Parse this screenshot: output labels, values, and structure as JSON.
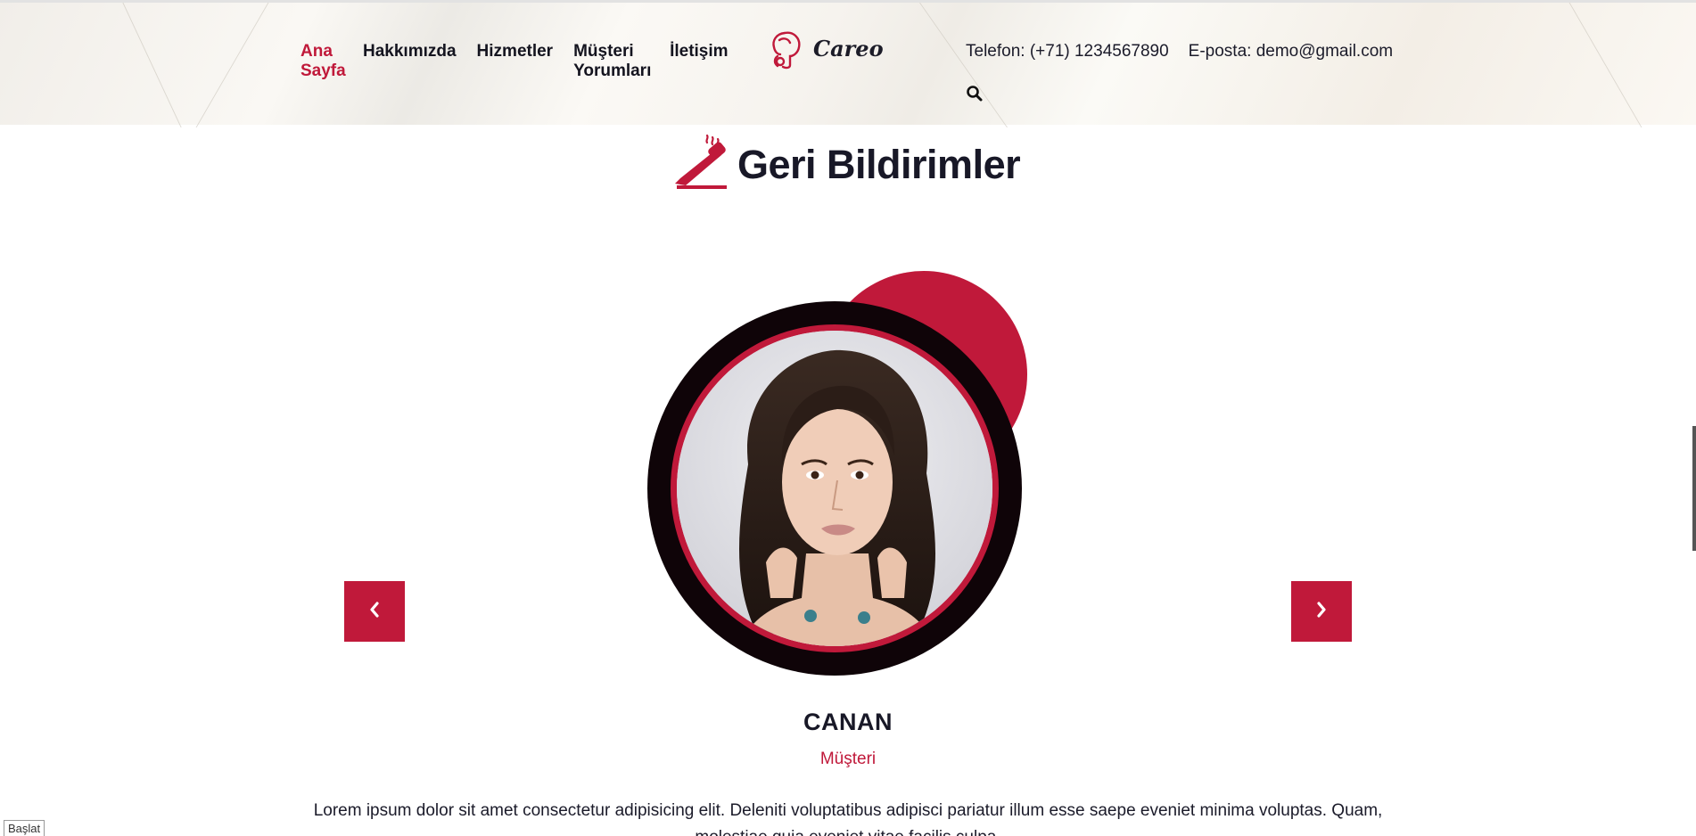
{
  "nav": {
    "items": [
      {
        "label": "Ana Sayfa",
        "active": true
      },
      {
        "label": "Hakkımızda",
        "active": false
      },
      {
        "label": "Hizmetler",
        "active": false
      },
      {
        "label": "Müşteri Yorumları",
        "active": false
      },
      {
        "label": "İletişim",
        "active": false
      }
    ]
  },
  "logo": {
    "text": "Careo",
    "icon": "woman-profile-icon"
  },
  "contact": {
    "phone": "Telefon: (+71) 1234567890",
    "email": "E-posta: demo@gmail.com"
  },
  "search": {
    "icon": "search-icon"
  },
  "section": {
    "title": "Geri Bildirimler",
    "icon": "hair-iron-icon"
  },
  "testimonial": {
    "name": "CANAN",
    "role": "Müşteri",
    "text": "Lorem ipsum dolor sit amet consectetur adipisicing elit. Deleniti voluptatibus adipisci pariatur illum esse saepe eveniet minima voluptas. Quam, molestiae quia eveniet vitae facilis culpa."
  },
  "carousel": {
    "prev_icon": "chevron-left-icon",
    "next_icon": "chevron-right-icon"
  },
  "status": {
    "label": "Başlat"
  },
  "colors": {
    "accent": "#c0193a",
    "dark": "#0f0408",
    "text": "#1b1b2a"
  }
}
